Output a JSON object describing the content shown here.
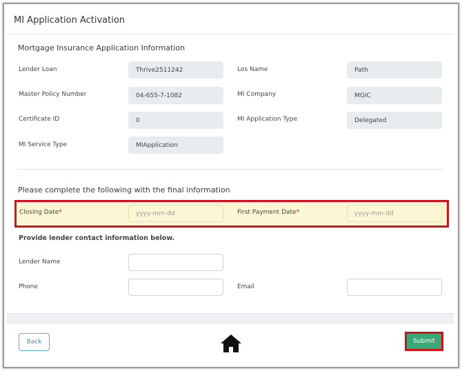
{
  "dialog": {
    "title": "MI Application Activation"
  },
  "info_section": {
    "title": "Mortgage Insurance Application Information",
    "fields": {
      "lender_loan": {
        "label": "Lender Loan",
        "value": "Thrive2511242"
      },
      "los_name": {
        "label": "Los Name",
        "value": "Path"
      },
      "master_policy": {
        "label": "Master Policy Number",
        "value": "04-655-7-1082"
      },
      "mi_company": {
        "label": "MI Company",
        "value": "MGIC"
      },
      "certificate_id": {
        "label": "Certificate ID",
        "value": "0"
      },
      "mi_app_type": {
        "label": "MI Application Type",
        "value": "Delegated"
      },
      "mi_service_type": {
        "label": "MI Service Type",
        "value": "MIApplication"
      }
    }
  },
  "final_section": {
    "title": "Please complete the following with the final information",
    "closing_date": {
      "label": "Closing Date",
      "required_mark": "*",
      "placeholder": "yyyy-mm-dd",
      "value": ""
    },
    "first_payment_date": {
      "label": "First Payment Date",
      "required_mark": "*",
      "placeholder": "yyyy-mm-dd",
      "value": ""
    }
  },
  "contact_section": {
    "title": "Provide lender contact information below.",
    "lender_name": {
      "label": "Lender Name",
      "value": ""
    },
    "phone": {
      "label": "Phone",
      "value": ""
    },
    "email": {
      "label": "Email",
      "value": ""
    }
  },
  "footer": {
    "back_label": "Back",
    "home_icon": "home-icon",
    "submit_label": "Submit"
  },
  "colors": {
    "highlight_border": "#d40f1c",
    "highlight_fill": "#fbf7d4",
    "submit": "#3aa876",
    "back_border": "#5bb3c4"
  }
}
